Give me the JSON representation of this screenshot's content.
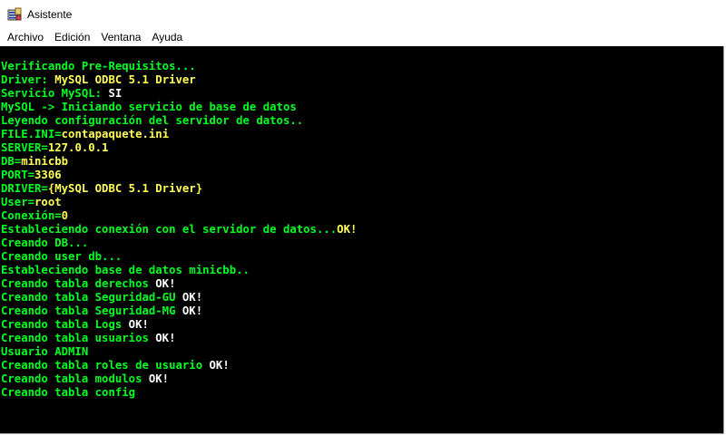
{
  "window": {
    "title": "Asistente",
    "icon": "installer-icon"
  },
  "menu": [
    {
      "label": "Archivo"
    },
    {
      "label": "Edición"
    },
    {
      "label": "Ventana"
    },
    {
      "label": "Ayuda"
    }
  ],
  "colors": {
    "green": "#00ff22",
    "yellow": "#ffff55",
    "white": "#ffffff",
    "background": "#000000"
  },
  "console": {
    "lines": [
      [
        {
          "t": "Verificando Pre-Requisitos...",
          "c": "green"
        }
      ],
      [
        {
          "t": "Driver: ",
          "c": "green"
        },
        {
          "t": "MySQL ODBC 5.1 Driver",
          "c": "yellow"
        }
      ],
      [
        {
          "t": "Servicio MySQL: ",
          "c": "green"
        },
        {
          "t": "SI",
          "c": "white"
        }
      ],
      [
        {
          "t": "MySQL -> Iniciando servicio de base de datos",
          "c": "green"
        }
      ],
      [
        {
          "t": "Leyendo configuración del servidor de datos..",
          "c": "green"
        }
      ],
      [
        {
          "t": "FILE.INI=",
          "c": "green"
        },
        {
          "t": "contapaquete.ini",
          "c": "yellow"
        }
      ],
      [
        {
          "t": "SERVER=",
          "c": "green"
        },
        {
          "t": "127.0.0.1",
          "c": "yellow"
        }
      ],
      [
        {
          "t": "DB=",
          "c": "green"
        },
        {
          "t": "minicbb",
          "c": "yellow"
        }
      ],
      [
        {
          "t": "PORT=",
          "c": "green"
        },
        {
          "t": "3306",
          "c": "yellow"
        }
      ],
      [
        {
          "t": "DRIVER=",
          "c": "green"
        },
        {
          "t": "{MySQL ODBC 5.1 Driver}",
          "c": "yellow"
        }
      ],
      [
        {
          "t": "User=",
          "c": "green"
        },
        {
          "t": "root",
          "c": "yellow"
        }
      ],
      [
        {
          "t": "Conexión=",
          "c": "green"
        },
        {
          "t": "0",
          "c": "yellow"
        }
      ],
      [
        {
          "t": "Estableciendo conexión con el servidor de datos...",
          "c": "green"
        },
        {
          "t": "OK!",
          "c": "yellow"
        }
      ],
      [
        {
          "t": "Creando DB...",
          "c": "green"
        }
      ],
      [
        {
          "t": "Creando user db...",
          "c": "green"
        }
      ],
      [
        {
          "t": "Estableciendo base de datos minicbb..",
          "c": "green"
        }
      ],
      [
        {
          "t": "Creando tabla derechos ",
          "c": "green"
        },
        {
          "t": "OK!",
          "c": "white"
        }
      ],
      [
        {
          "t": "Creando tabla Seguridad-GU ",
          "c": "green"
        },
        {
          "t": "OK!",
          "c": "white"
        }
      ],
      [
        {
          "t": "Creando tabla Seguridad-MG ",
          "c": "green"
        },
        {
          "t": "OK!",
          "c": "white"
        }
      ],
      [
        {
          "t": "Creando tabla Logs ",
          "c": "green"
        },
        {
          "t": "OK!",
          "c": "white"
        }
      ],
      [
        {
          "t": "Creando tabla usuarios ",
          "c": "green"
        },
        {
          "t": "OK!",
          "c": "white"
        }
      ],
      [
        {
          "t": "Usuario ADMIN",
          "c": "green"
        }
      ],
      [
        {
          "t": "Creando tabla roles de usuario ",
          "c": "green"
        },
        {
          "t": "OK!",
          "c": "white"
        }
      ],
      [
        {
          "t": "Creando tabla modulos ",
          "c": "green"
        },
        {
          "t": "OK!",
          "c": "white"
        }
      ],
      [
        {
          "t": "Creando tabla config",
          "c": "green"
        }
      ]
    ]
  }
}
